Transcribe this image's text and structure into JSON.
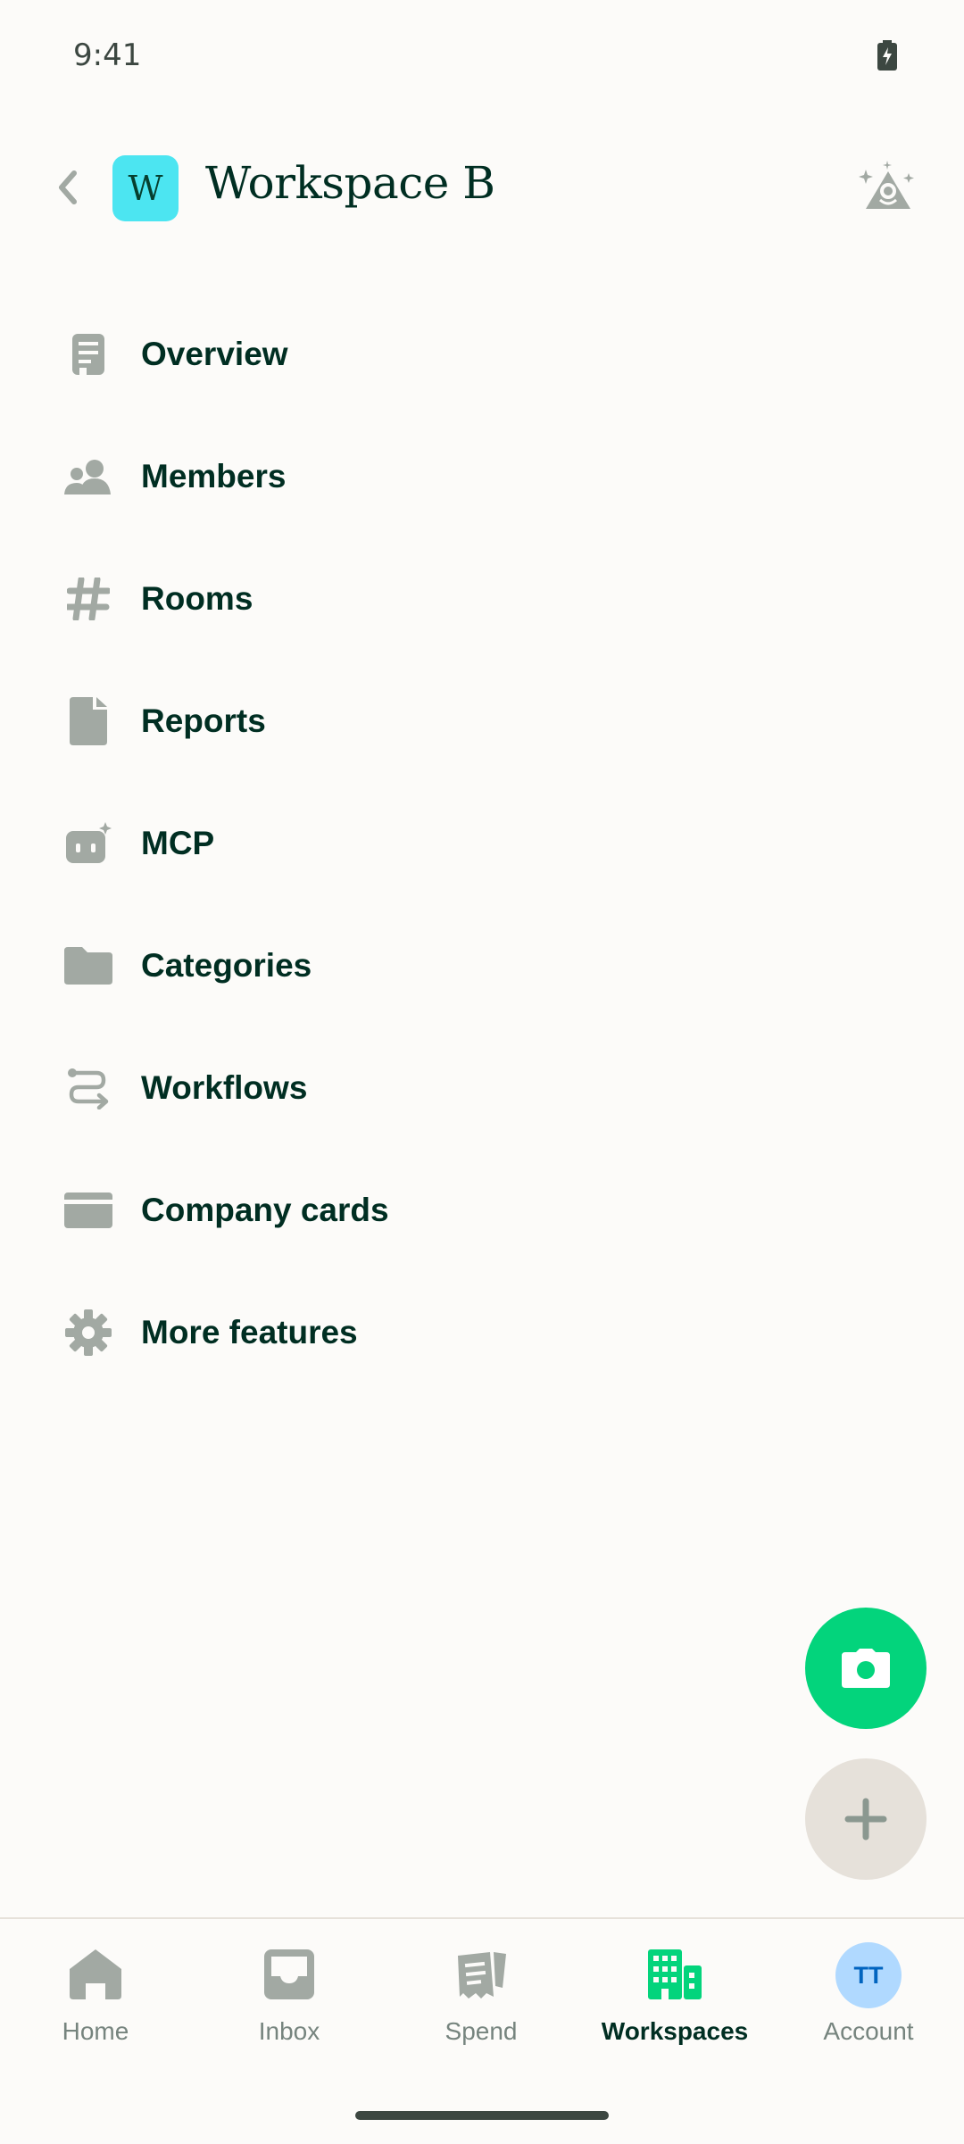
{
  "status_bar": {
    "time": "9:41"
  },
  "header": {
    "workspace_initial": "W",
    "title": "Workspace B"
  },
  "menu": [
    {
      "label": "Overview",
      "icon": "document-icon"
    },
    {
      "label": "Members",
      "icon": "users-icon"
    },
    {
      "label": "Rooms",
      "icon": "hashtag-icon"
    },
    {
      "label": "Reports",
      "icon": "file-icon"
    },
    {
      "label": "MCP",
      "icon": "robot-icon"
    },
    {
      "label": "Categories",
      "icon": "folder-icon"
    },
    {
      "label": "Workflows",
      "icon": "workflow-icon"
    },
    {
      "label": "Company cards",
      "icon": "credit-card-icon"
    },
    {
      "label": "More features",
      "icon": "gear-icon"
    }
  ],
  "bottom_nav": {
    "tabs": [
      {
        "label": "Home",
        "icon": "home-icon",
        "active": false
      },
      {
        "label": "Inbox",
        "icon": "inbox-icon",
        "active": false
      },
      {
        "label": "Spend",
        "icon": "receipts-icon",
        "active": false
      },
      {
        "label": "Workspaces",
        "icon": "building-icon",
        "active": true
      },
      {
        "label": "Account",
        "icon": "avatar",
        "active": false
      }
    ],
    "account_initials": "TT"
  },
  "colors": {
    "background": "#FCFBF9",
    "text": "#002E22",
    "icon": "#A2A9A3",
    "accent_green": "#03D47C",
    "workspace_avatar": "#4CE5F1",
    "account_avatar": "#B0D9FF"
  }
}
